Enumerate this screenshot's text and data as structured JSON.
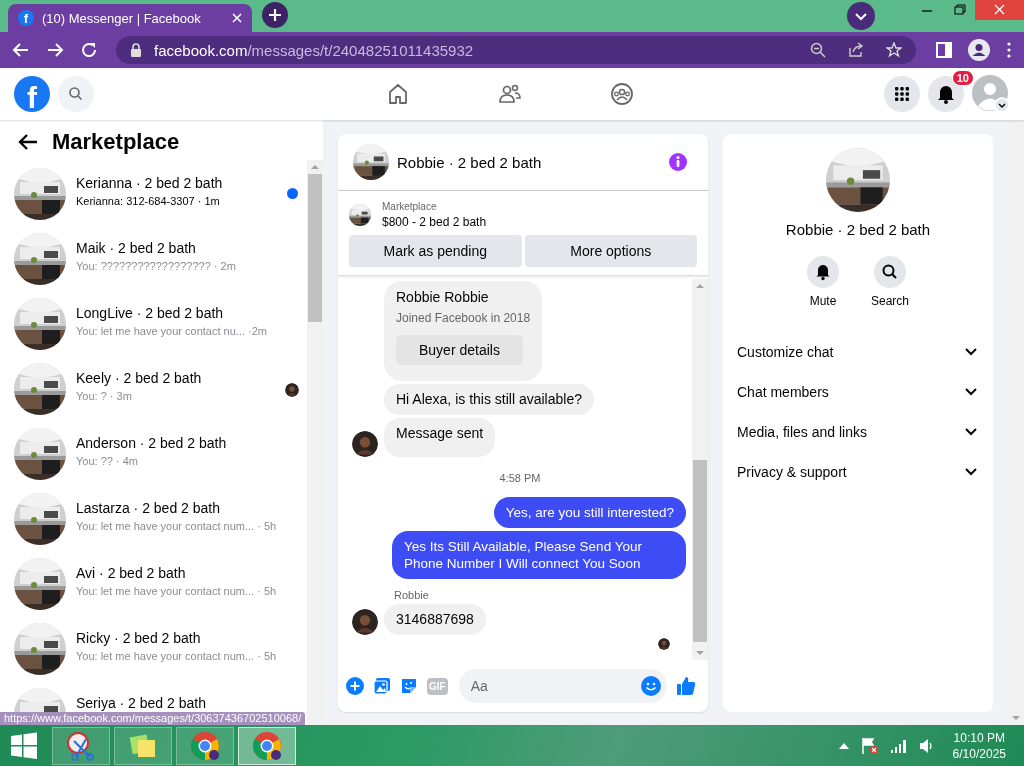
{
  "browser": {
    "favicon": "f",
    "tabs": [
      {
        "title": "(10) Messenger | Facebook",
        "selected": true
      }
    ],
    "address": {
      "domain": "facebook.com",
      "path": "/messages/t/24048251011435932"
    }
  },
  "fb_nav": {
    "logo": "f",
    "notifications_badge": "10"
  },
  "conversations": {
    "title": "Marketplace",
    "items": [
      {
        "name": "Kerianna · 2 bed 2 bath",
        "preview": "Kerianna: 312-684-3307",
        "time": "· 1m",
        "unread": true,
        "seen": false
      },
      {
        "name": "Maik · 2 bed 2 bath",
        "preview": "You: ??????????????????",
        "time": "· 2m",
        "unread": false,
        "seen": false
      },
      {
        "name": "LongLive · 2 bed 2 bath",
        "preview": "You: let me have your contact nu...",
        "time": "·2m",
        "unread": false,
        "seen": false
      },
      {
        "name": "Keely · 2 bed 2 bath",
        "preview": "You: ?",
        "time": "· 3m",
        "unread": false,
        "seen": true
      },
      {
        "name": "Anderson · 2 bed 2 bath",
        "preview": "You: ??",
        "time": "· 4m",
        "unread": false,
        "seen": false
      },
      {
        "name": "Lastarza · 2 bed 2 bath",
        "preview": "You: let me have your contact num...",
        "time": "· 5h",
        "unread": false,
        "seen": false
      },
      {
        "name": "Avi · 2 bed 2 bath",
        "preview": "You: let me have your contact num...",
        "time": "· 5h",
        "unread": false,
        "seen": false
      },
      {
        "name": "Ricky · 2 bed 2 bath",
        "preview": "You: let me have your contact num...",
        "time": "· 5h",
        "unread": false,
        "seen": false
      },
      {
        "name": "Seriya · 2 bed 2 bath",
        "unread": false,
        "seen": false
      }
    ]
  },
  "chat": {
    "title": "Robbie · 2 bed 2 bath",
    "listing": {
      "label": "Marketplace",
      "title": "$800 - 2 bed 2 bath"
    },
    "actions": [
      "Mark as pending",
      "More options"
    ],
    "messages": [
      {
        "kind": "card",
        "name": "Robbie Robbie",
        "subtitle": "Joined Facebook in 2018",
        "button": "Buyer details"
      },
      {
        "kind": "in",
        "text": "Hi Alexa, is this still available?",
        "avatar": false
      },
      {
        "kind": "in",
        "text": "Message sent",
        "avatar": true
      },
      {
        "kind": "time",
        "text": "4:58 PM"
      },
      {
        "kind": "out",
        "text": "Yes, are you still interested?"
      },
      {
        "kind": "out",
        "text": "Yes Its Still Available, Please Send Your Phone Number I Will connect You Soon"
      },
      {
        "kind": "sender",
        "text": "Robbie"
      },
      {
        "kind": "in",
        "text": "3146887698",
        "avatar": true
      },
      {
        "kind": "seen"
      }
    ],
    "composer": {
      "gif_label": "GIF",
      "placeholder": "Aa"
    }
  },
  "details": {
    "title": "Robbie · 2 bed 2 bath",
    "actions": [
      {
        "kind": "bell",
        "label": "Mute"
      },
      {
        "kind": "search",
        "label": "Search"
      }
    ],
    "sections": [
      {
        "label": "Customize chat",
        "expanded": false
      },
      {
        "label": "Chat members",
        "expanded": false
      },
      {
        "label": "Media, files and links",
        "expanded": false
      },
      {
        "label": "Privacy & support",
        "expanded": false
      }
    ]
  },
  "status_link": "https://www.facebook.com/messages/t/30637436702510068/",
  "taskbar": {
    "apps": [
      {
        "kind": "scissors",
        "selected": false
      },
      {
        "kind": "notes",
        "selected": false
      },
      {
        "kind": "browser",
        "selected": false
      },
      {
        "kind": "browser",
        "selected": true
      }
    ],
    "time": "10:10 PM",
    "date": "6/10/2025"
  }
}
